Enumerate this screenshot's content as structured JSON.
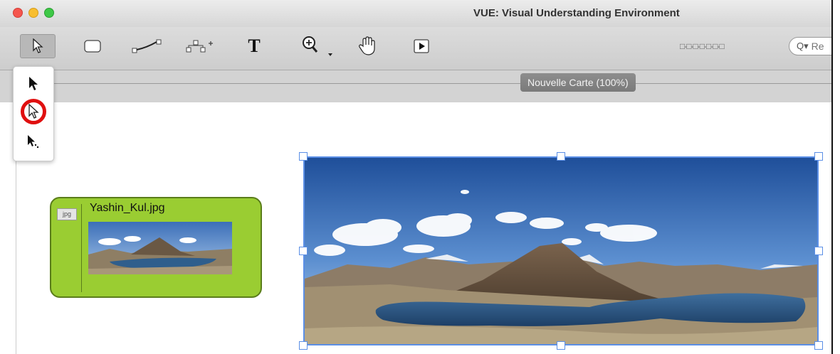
{
  "window": {
    "title": "VUE: Visual Understanding Environment",
    "controls": [
      "close",
      "minimize",
      "zoom"
    ]
  },
  "toolbar": {
    "tools": [
      {
        "name": "selection-tool",
        "icon": "hollow-arrow-icon",
        "selected": true
      },
      {
        "name": "node-tool",
        "icon": "rounded-rectangle-icon"
      },
      {
        "name": "link-tool",
        "icon": "link-icon"
      },
      {
        "name": "ontology-tool",
        "icon": "hierarchy-icon"
      },
      {
        "name": "text-tool",
        "icon": "text-icon",
        "label": "T"
      },
      {
        "name": "zoom-tool",
        "icon": "magnifier-plus-icon"
      },
      {
        "name": "pan-tool",
        "icon": "hand-icon"
      },
      {
        "name": "presentation-tool",
        "icon": "play-icon"
      }
    ],
    "search_placeholder": "Re"
  },
  "tab": {
    "label": "Nouvelle Carte (100%)"
  },
  "selection_popup": {
    "items": [
      {
        "name": "select-solid-arrow",
        "icon": "solid-arrow-icon"
      },
      {
        "name": "select-hollow-arrow",
        "icon": "hollow-arrow-icon",
        "highlighted": true
      },
      {
        "name": "select-arrow-dotted",
        "icon": "arrow-dotted-icon"
      }
    ],
    "highlight_color": "#e01010"
  },
  "map": {
    "node": {
      "badge": "jpg",
      "title": "Yashin_Kul.jpg",
      "fill_color": "#9acd32"
    },
    "selected_image": {
      "selection_color": "#5b8fe6"
    }
  }
}
